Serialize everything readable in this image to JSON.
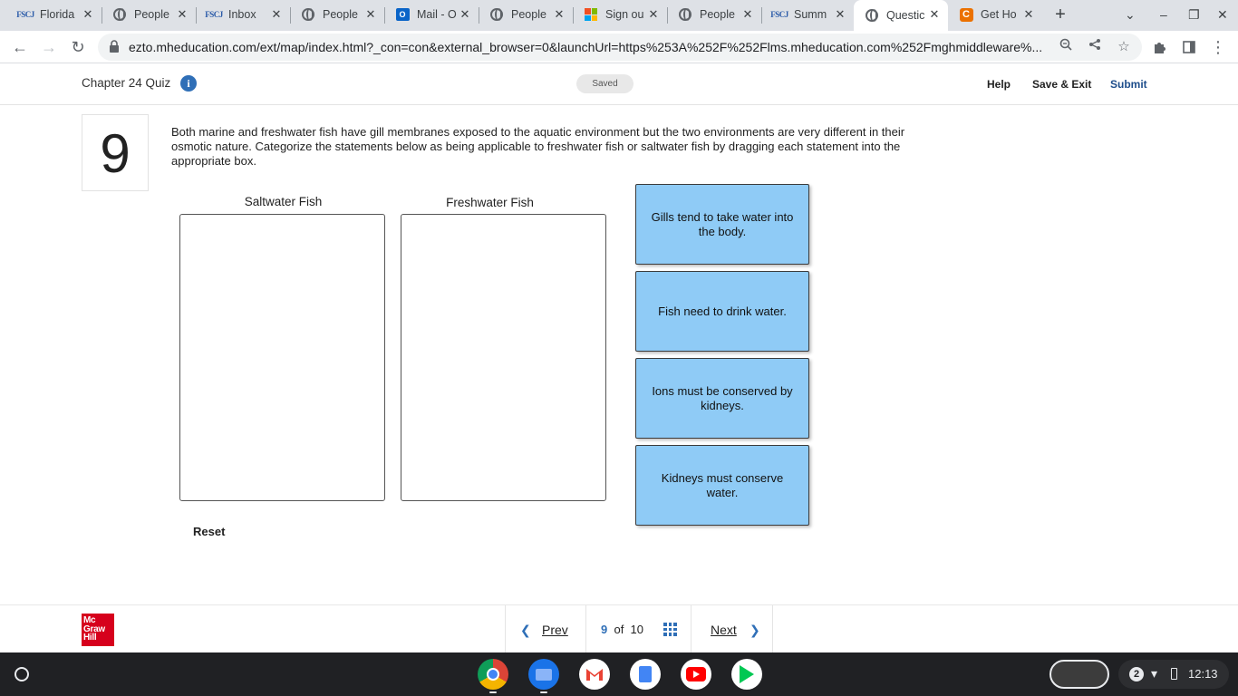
{
  "browser": {
    "tabs": [
      {
        "label": "Florida",
        "icon": "fscj-icon"
      },
      {
        "label": "People",
        "icon": "globe-icon"
      },
      {
        "label": "Inbox",
        "icon": "fscj-icon"
      },
      {
        "label": "People",
        "icon": "globe-icon"
      },
      {
        "label": "Mail - O",
        "icon": "outlook-icon"
      },
      {
        "label": "People",
        "icon": "globe-icon"
      },
      {
        "label": "Sign ou",
        "icon": "microsoft-icon"
      },
      {
        "label": "People",
        "icon": "globe-icon"
      },
      {
        "label": "Summ",
        "icon": "fscj-icon"
      },
      {
        "label": "Questic",
        "icon": "globe-icon",
        "active": true
      },
      {
        "label": "Get Ho",
        "icon": "chegg-icon"
      }
    ],
    "fscj_text": "FSCJ",
    "outlook_text": "O",
    "chegg_text": "C",
    "url": "ezto.mheducation.com/ext/map/index.html?_con=con&external_browser=0&launchUrl=https%253A%252F%252Flms.mheducation.com%252Fmghmiddleware%..."
  },
  "quiz_header": {
    "title": "Chapter 24 Quiz",
    "info_glyph": "i",
    "status": "Saved",
    "help": "Help",
    "save_exit": "Save & Exit",
    "submit": "Submit"
  },
  "question": {
    "number": "9",
    "text": "Both marine and freshwater fish have gill membranes exposed to the aquatic environment but the two environments are very different in their osmotic nature. Categorize the statements below as being applicable to freshwater fish or saltwater fish by dragging each statement into the appropriate box.",
    "boxes": [
      "Saltwater Fish",
      "Freshwater Fish"
    ],
    "cards": [
      "Gills tend to take water into the body.",
      "Fish need to drink water.",
      "Ions must be conserved by kidneys.",
      "Kidneys must conserve water."
    ],
    "reset": "Reset"
  },
  "footer": {
    "logo_lines": [
      "Mc",
      "Graw",
      "Hill"
    ],
    "prev": "Prev",
    "current_page": "9",
    "of": "of",
    "total_pages": "10",
    "next": "Next"
  },
  "shelf": {
    "apps": [
      "chrome-icon",
      "files-icon",
      "gmail-icon",
      "docs-icon",
      "youtube-icon",
      "play-store-icon"
    ],
    "notification_count": "2",
    "time": "12:13"
  }
}
